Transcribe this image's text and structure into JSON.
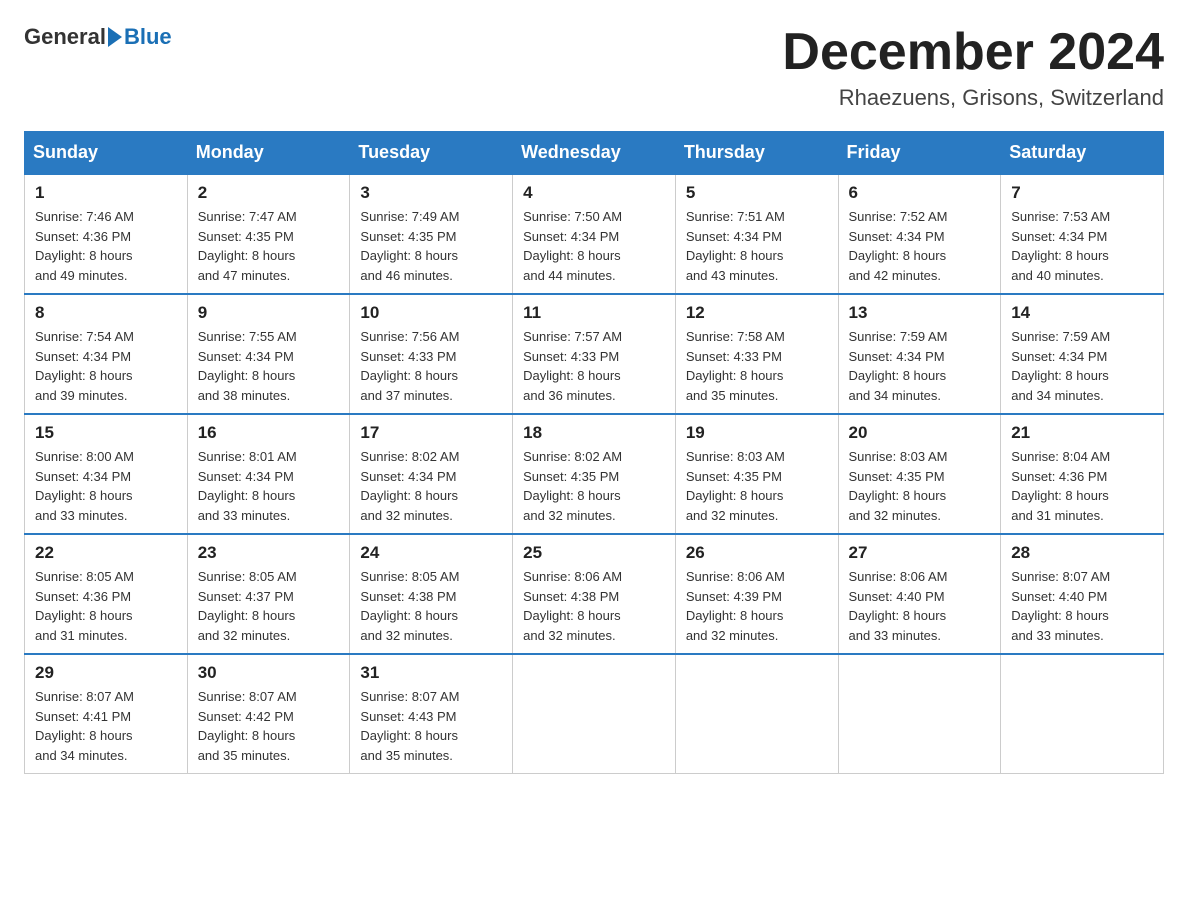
{
  "header": {
    "logo_general": "General",
    "logo_blue": "Blue",
    "month_title": "December 2024",
    "location": "Rhaezuens, Grisons, Switzerland"
  },
  "days_of_week": [
    "Sunday",
    "Monday",
    "Tuesday",
    "Wednesday",
    "Thursday",
    "Friday",
    "Saturday"
  ],
  "weeks": [
    [
      {
        "day": "1",
        "info": "Sunrise: 7:46 AM\nSunset: 4:36 PM\nDaylight: 8 hours\nand 49 minutes."
      },
      {
        "day": "2",
        "info": "Sunrise: 7:47 AM\nSunset: 4:35 PM\nDaylight: 8 hours\nand 47 minutes."
      },
      {
        "day": "3",
        "info": "Sunrise: 7:49 AM\nSunset: 4:35 PM\nDaylight: 8 hours\nand 46 minutes."
      },
      {
        "day": "4",
        "info": "Sunrise: 7:50 AM\nSunset: 4:34 PM\nDaylight: 8 hours\nand 44 minutes."
      },
      {
        "day": "5",
        "info": "Sunrise: 7:51 AM\nSunset: 4:34 PM\nDaylight: 8 hours\nand 43 minutes."
      },
      {
        "day": "6",
        "info": "Sunrise: 7:52 AM\nSunset: 4:34 PM\nDaylight: 8 hours\nand 42 minutes."
      },
      {
        "day": "7",
        "info": "Sunrise: 7:53 AM\nSunset: 4:34 PM\nDaylight: 8 hours\nand 40 minutes."
      }
    ],
    [
      {
        "day": "8",
        "info": "Sunrise: 7:54 AM\nSunset: 4:34 PM\nDaylight: 8 hours\nand 39 minutes."
      },
      {
        "day": "9",
        "info": "Sunrise: 7:55 AM\nSunset: 4:34 PM\nDaylight: 8 hours\nand 38 minutes."
      },
      {
        "day": "10",
        "info": "Sunrise: 7:56 AM\nSunset: 4:33 PM\nDaylight: 8 hours\nand 37 minutes."
      },
      {
        "day": "11",
        "info": "Sunrise: 7:57 AM\nSunset: 4:33 PM\nDaylight: 8 hours\nand 36 minutes."
      },
      {
        "day": "12",
        "info": "Sunrise: 7:58 AM\nSunset: 4:33 PM\nDaylight: 8 hours\nand 35 minutes."
      },
      {
        "day": "13",
        "info": "Sunrise: 7:59 AM\nSunset: 4:34 PM\nDaylight: 8 hours\nand 34 minutes."
      },
      {
        "day": "14",
        "info": "Sunrise: 7:59 AM\nSunset: 4:34 PM\nDaylight: 8 hours\nand 34 minutes."
      }
    ],
    [
      {
        "day": "15",
        "info": "Sunrise: 8:00 AM\nSunset: 4:34 PM\nDaylight: 8 hours\nand 33 minutes."
      },
      {
        "day": "16",
        "info": "Sunrise: 8:01 AM\nSunset: 4:34 PM\nDaylight: 8 hours\nand 33 minutes."
      },
      {
        "day": "17",
        "info": "Sunrise: 8:02 AM\nSunset: 4:34 PM\nDaylight: 8 hours\nand 32 minutes."
      },
      {
        "day": "18",
        "info": "Sunrise: 8:02 AM\nSunset: 4:35 PM\nDaylight: 8 hours\nand 32 minutes."
      },
      {
        "day": "19",
        "info": "Sunrise: 8:03 AM\nSunset: 4:35 PM\nDaylight: 8 hours\nand 32 minutes."
      },
      {
        "day": "20",
        "info": "Sunrise: 8:03 AM\nSunset: 4:35 PM\nDaylight: 8 hours\nand 32 minutes."
      },
      {
        "day": "21",
        "info": "Sunrise: 8:04 AM\nSunset: 4:36 PM\nDaylight: 8 hours\nand 31 minutes."
      }
    ],
    [
      {
        "day": "22",
        "info": "Sunrise: 8:05 AM\nSunset: 4:36 PM\nDaylight: 8 hours\nand 31 minutes."
      },
      {
        "day": "23",
        "info": "Sunrise: 8:05 AM\nSunset: 4:37 PM\nDaylight: 8 hours\nand 32 minutes."
      },
      {
        "day": "24",
        "info": "Sunrise: 8:05 AM\nSunset: 4:38 PM\nDaylight: 8 hours\nand 32 minutes."
      },
      {
        "day": "25",
        "info": "Sunrise: 8:06 AM\nSunset: 4:38 PM\nDaylight: 8 hours\nand 32 minutes."
      },
      {
        "day": "26",
        "info": "Sunrise: 8:06 AM\nSunset: 4:39 PM\nDaylight: 8 hours\nand 32 minutes."
      },
      {
        "day": "27",
        "info": "Sunrise: 8:06 AM\nSunset: 4:40 PM\nDaylight: 8 hours\nand 33 minutes."
      },
      {
        "day": "28",
        "info": "Sunrise: 8:07 AM\nSunset: 4:40 PM\nDaylight: 8 hours\nand 33 minutes."
      }
    ],
    [
      {
        "day": "29",
        "info": "Sunrise: 8:07 AM\nSunset: 4:41 PM\nDaylight: 8 hours\nand 34 minutes."
      },
      {
        "day": "30",
        "info": "Sunrise: 8:07 AM\nSunset: 4:42 PM\nDaylight: 8 hours\nand 35 minutes."
      },
      {
        "day": "31",
        "info": "Sunrise: 8:07 AM\nSunset: 4:43 PM\nDaylight: 8 hours\nand 35 minutes."
      },
      null,
      null,
      null,
      null
    ]
  ]
}
